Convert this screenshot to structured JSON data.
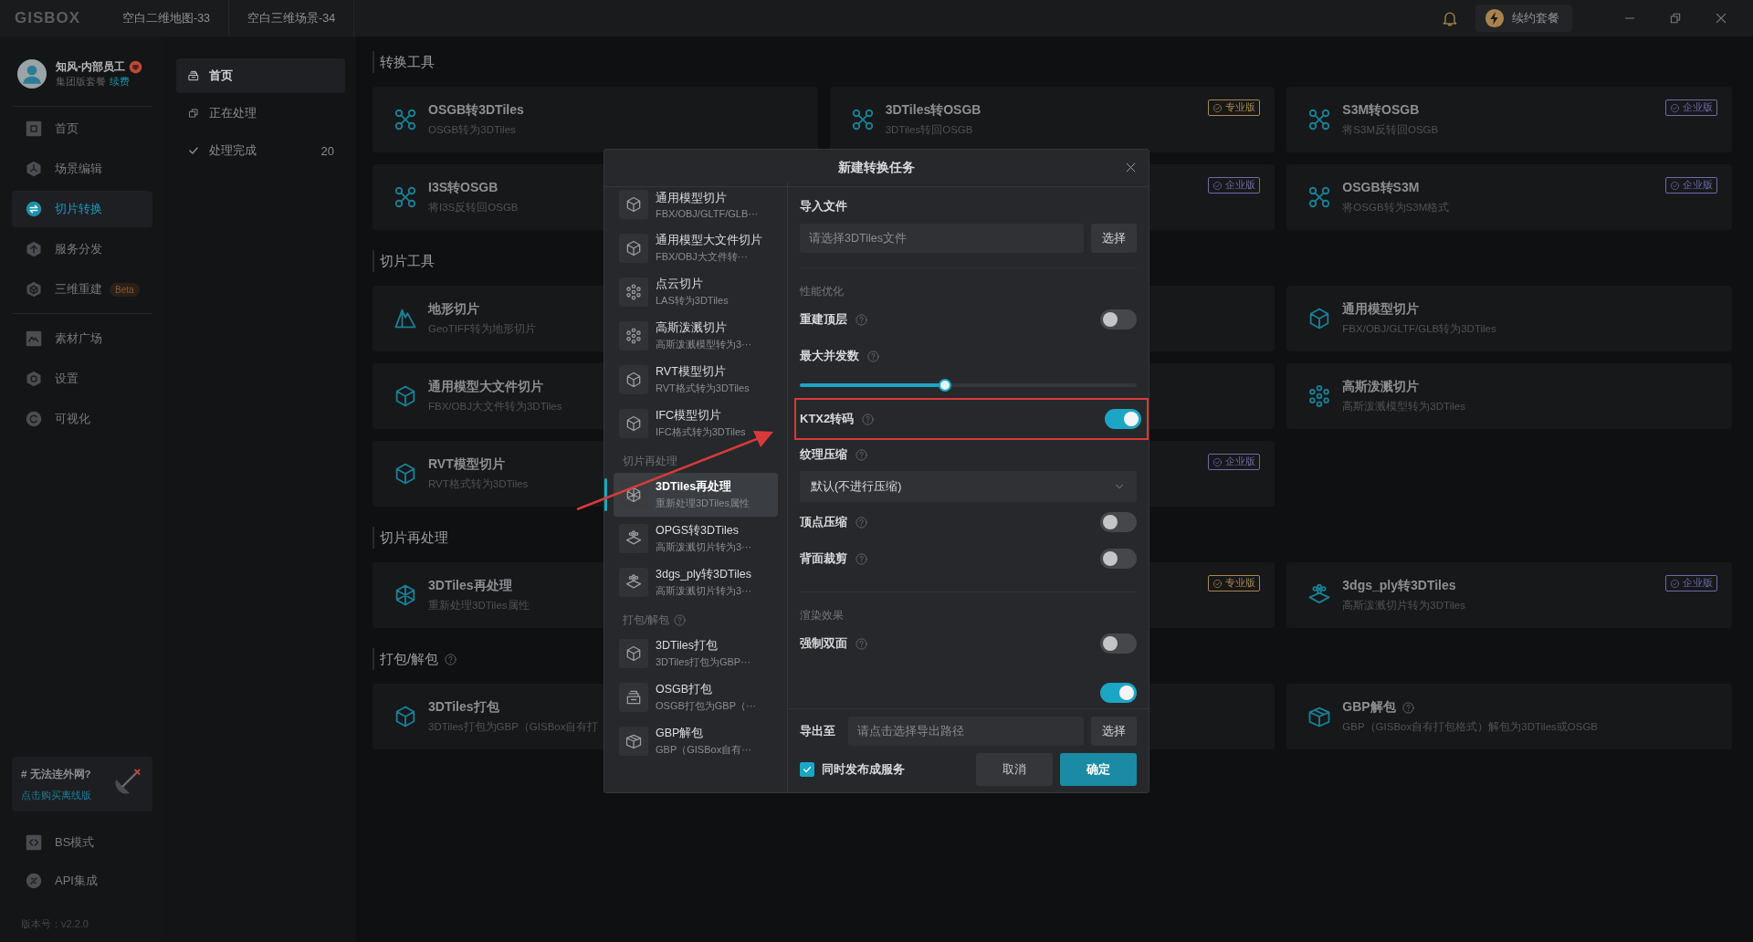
{
  "title_bar": {
    "logo": "GISBOX",
    "tabs": [
      {
        "label": "空白二维地图-33",
        "selected": false
      },
      {
        "label": "空白三维场景-34",
        "selected": false
      }
    ],
    "renew_button": "续约套餐"
  },
  "user": {
    "name": "知风-内部员工",
    "plan": "集团版套餐",
    "renew_link": "续费"
  },
  "nav": [
    {
      "label": "首页",
      "selected": false
    },
    {
      "label": "场景编辑",
      "selected": false
    },
    {
      "label": "切片转换",
      "selected": true
    },
    {
      "label": "服务分发",
      "selected": false
    },
    {
      "label": "三维重建",
      "selected": false,
      "badge": "Beta"
    }
  ],
  "nav_more": [
    {
      "label": "素材广场",
      "selected": false
    },
    {
      "label": "设置",
      "selected": false
    },
    {
      "label": "可视化",
      "selected": false
    }
  ],
  "promo": {
    "title": "# 无法连外网?",
    "link": "点击购买离线版"
  },
  "nav_bottom": [
    {
      "label": "BS模式",
      "selected": false
    },
    {
      "label": "API集成",
      "selected": false
    }
  ],
  "version": "版本号：v2.2.0",
  "subnav": [
    {
      "label": "首页",
      "selected": true
    },
    {
      "label": "正在处理",
      "selected": false
    },
    {
      "label": "处理完成",
      "count": "20",
      "selected": false
    }
  ],
  "sections": [
    {
      "title": "转换工具",
      "help": false,
      "cards": [
        {
          "kind": "tool",
          "title": "OSGB转3DTiles",
          "desc": "OSGB转为3DTiles"
        },
        {
          "kind": "tool",
          "title": "3DTiles转OSGB",
          "desc": "3DTiles转回OSGB",
          "badge": {
            "label": "专业版",
            "color": "#a8874a"
          }
        },
        {
          "kind": "tool",
          "title": "S3M转OSGB",
          "desc": "将S3M反转回OSGB",
          "badge": {
            "label": "企业版",
            "color": "#6d6aa8"
          }
        },
        {
          "kind": "tool",
          "title": "I3S转OSGB",
          "desc": "将I3S反转回OSGB"
        },
        {
          "kind": "tool",
          "badge": {
            "label": "企业版",
            "color": "#6d6aa8"
          }
        },
        {
          "kind": "tool",
          "title": "OSGB转S3M",
          "desc": "将OSGB转为S3M格式",
          "badge": {
            "label": "企业版",
            "color": "#6d6aa8"
          }
        }
      ]
    },
    {
      "title": "切片工具",
      "help": false,
      "cards": [
        {
          "kind": "tool",
          "title": "地形切片",
          "desc": "GeoTIFF转为地形切片"
        },
        {
          "kind": "blank"
        },
        {
          "kind": "tool",
          "title": "通用模型切片",
          "desc": "FBX/OBJ/GLTF/GLB转为3DTiles"
        },
        {
          "kind": "tool",
          "title": "通用模型大文件切片",
          "desc": "FBX/OBJ大文件转为3DTiles"
        },
        {
          "kind": "blank"
        },
        {
          "kind": "tool",
          "title": "高斯泼溅切片",
          "desc": "高斯泼溅模型转为3DTiles"
        },
        {
          "kind": "tool",
          "title": "RVT模型切片",
          "desc": "RVT格式转为3DTiles"
        },
        {
          "kind": "tool",
          "badge": {
            "label": "企业版",
            "color": "#6d6aa8"
          }
        }
      ]
    },
    {
      "title": "切片再处理",
      "help": false,
      "cards": [
        {
          "kind": "tool",
          "title": "3DTiles再处理",
          "desc": "重新处理3DTiles属性"
        },
        {
          "kind": "tool",
          "badge": {
            "label": "专业版",
            "color": "#a8874a"
          }
        },
        {
          "kind": "tool",
          "title": "3dgs_ply转3DTiles",
          "desc": "高斯泼溅切片转为3DTiles",
          "badge": {
            "label": "企业版",
            "color": "#6d6aa8"
          }
        }
      ]
    },
    {
      "title": "打包/解包",
      "help": true,
      "cards": [
        {
          "kind": "tool",
          "title": "3DTiles打包",
          "desc": "3DTiles打包为GBP（GISBox自有打"
        },
        {
          "kind": "blank"
        },
        {
          "kind": "tool",
          "title": "GBP解包",
          "help": true,
          "desc": "GBP（GISBox自有打包格式）解包为3DTiles或OSGB"
        }
      ]
    }
  ],
  "dialog": {
    "title": "新建转换任务",
    "tool_groups": [
      {
        "items": [
          {
            "title": "通用模型切片",
            "desc": "FBX/OBJ/GLTF/GLB···",
            "selected": false
          },
          {
            "title": "通用模型大文件切片",
            "desc": "FBX/OBJ大文件转···",
            "selected": false
          },
          {
            "title": "点云切片",
            "desc": "LAS转为3DTiles",
            "selected": false
          },
          {
            "title": "高斯泼溅切片",
            "desc": "高斯泼溅模型转为3···",
            "selected": false
          },
          {
            "title": "RVT模型切片",
            "desc": "RVT格式转为3DTiles",
            "selected": false
          },
          {
            "title": "IFC模型切片",
            "desc": "IFC格式转为3DTiles",
            "selected": false
          }
        ]
      },
      {
        "label": "切片再处理",
        "help": false,
        "items": [
          {
            "title": "3DTiles再处理",
            "desc": "重新处理3DTiles属性",
            "selected": true
          },
          {
            "title": "OPGS转3DTiles",
            "desc": "高斯泼溅切片转为3···",
            "selected": false
          },
          {
            "title": "3dgs_ply转3DTiles",
            "desc": "高斯泼溅切片转为3···",
            "selected": false
          }
        ]
      },
      {
        "label": "打包/解包",
        "help": true,
        "items": [
          {
            "title": "3DTiles打包",
            "desc": "3DTiles打包为GBP···",
            "selected": false
          },
          {
            "title": "OSGB打包",
            "desc": "OSGB打包为GBP（···",
            "selected": false
          },
          {
            "title": "GBP解包",
            "desc": "GBP（GISBox自有···",
            "selected": false
          }
        ]
      }
    ],
    "import": {
      "label": "导入文件",
      "placeholder": "请选择3DTiles文件",
      "button": "选择"
    },
    "settings": [
      {
        "kind": "section",
        "label": "性能优化"
      },
      {
        "kind": "toggle",
        "label": "重建顶层",
        "help": true,
        "on": false,
        "highlighted": false
      },
      {
        "kind": "slider",
        "label": "最大并发数",
        "help": true,
        "level": 0.43
      },
      {
        "kind": "toggle",
        "label": "KTX2转码",
        "help": true,
        "on": true,
        "highlighted": true
      },
      {
        "kind": "select",
        "label": "纹理压缩",
        "help": true,
        "value": "默认(不进行压缩)"
      },
      {
        "kind": "toggle",
        "label": "顶点压缩",
        "help": true,
        "on": false,
        "highlighted": false
      },
      {
        "kind": "toggle",
        "label": "背面裁剪",
        "help": true,
        "on": false,
        "highlighted": false
      },
      {
        "kind": "section",
        "label": "渲染效果"
      },
      {
        "kind": "toggle",
        "label": "强制双面",
        "help": true,
        "on": false,
        "highlighted": false
      },
      {
        "kind": "toggle",
        "on": true
      }
    ],
    "export": {
      "label": "导出至",
      "placeholder": "请点击选择导出路径",
      "button": "选择"
    },
    "publish": {
      "label": "同时发布成服务",
      "checked": true
    },
    "cancel_button": "取消",
    "confirm_button": "确定"
  }
}
